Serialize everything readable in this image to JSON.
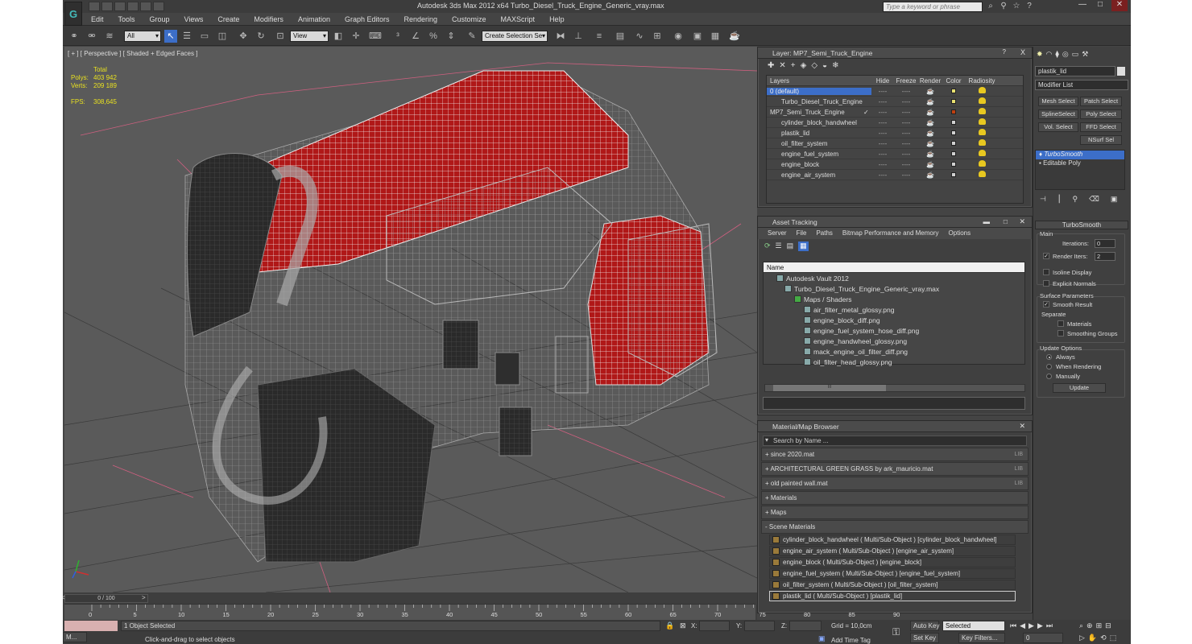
{
  "window": {
    "title": "Autodesk 3ds Max  2012 x64       Turbo_Diesel_Truck_Engine_Generic_vray.max",
    "search_placeholder": "Type a keyword or phrase"
  },
  "menu": [
    "Edit",
    "Tools",
    "Group",
    "Views",
    "Create",
    "Modifiers",
    "Animation",
    "Graph Editors",
    "Rendering",
    "Customize",
    "MAXScript",
    "Help"
  ],
  "toolbar": {
    "selection_filter": "All",
    "ref_coord": "View",
    "named_selection": "Create Selection Se"
  },
  "viewport": {
    "label": "[ + ] [ Perspective ] [ Shaded + Edged Faces ]",
    "stats": {
      "header": "Total",
      "polys_label": "Polys:",
      "polys": "403 942",
      "verts_label": "Verts:",
      "verts": "209 189",
      "fps_label": "FPS:",
      "fps": "308,645"
    }
  },
  "layer_panel": {
    "title": "Layer: MP7_Semi_Truck_Engine",
    "help": "?",
    "close": "X",
    "columns": [
      "Layers",
      "Hide",
      "Freeze",
      "Render",
      "Color",
      "Radiosity"
    ],
    "rows": [
      {
        "name": "0 (default)",
        "color": "#e8e070"
      },
      {
        "name": "Turbo_Diesel_Truck_Engine",
        "color": "#e8e070"
      },
      {
        "name": "MP7_Semi_Truck_Engine",
        "color": "#c04010"
      },
      {
        "name": "cylinder_block_handwheel",
        "color": "#d0d0d0"
      },
      {
        "name": "plastik_lid",
        "color": "#d0d0d0"
      },
      {
        "name": "oil_filter_system",
        "color": "#d0d0d0"
      },
      {
        "name": "engine_fuel_system",
        "color": "#d0d0d0"
      },
      {
        "name": "engine_block",
        "color": "#d0d0d0"
      },
      {
        "name": "engine_air_system",
        "color": "#d0d0d0"
      }
    ],
    "hide_mark": "----",
    "check_mark": "✓"
  },
  "asset_panel": {
    "title": "Asset Tracking",
    "menu": [
      "Server",
      "File",
      "Paths",
      "Bitmap Performance and Memory",
      "Options"
    ],
    "column": "Name",
    "tree": [
      "Autodesk Vault 2012",
      "Turbo_Diesel_Truck_Engine_Generic_vray.max",
      "Maps / Shaders",
      "air_filter_metal_glossy.png",
      "engine_block_diff.png",
      "engine_fuel_system_hose_diff.png",
      "engine_handwheel_glossy.png",
      "mack_engine_oil_filter_diff.png",
      "oil_filter_head_glossy.png"
    ],
    "scroll_grip": "III"
  },
  "material_panel": {
    "title": "Material/Map Browser",
    "search_placeholder": "Search by Name ...",
    "libraries": [
      "+ since 2020.mat",
      "+ ARCHITECTURAL GREEN GRASS by ark_mauricio.mat",
      "+ old painted wall.mat"
    ],
    "lib_tag": "LIB",
    "groups": [
      "+ Materials",
      "+ Maps",
      "- Scene Materials"
    ],
    "scene_materials": [
      "cylinder_block_handwheel  ( Multi/Sub-Object ) [cylinder_block_handwheel]",
      "engine_air_system  ( Multi/Sub-Object ) [engine_air_system]",
      "engine_block  ( Multi/Sub-Object ) [engine_block]",
      "engine_fuel_system  ( Multi/Sub-Object ) [engine_fuel_system]",
      "oil_filter_system  ( Multi/Sub-Object ) [oil_filter_system]",
      "plastik_lid  ( Multi/Sub-Object ) [plastik_lid]"
    ]
  },
  "command_panel": {
    "object_name": "plastik_lid",
    "modifier_list": "Modifier List",
    "buttons": [
      "Mesh Select",
      "Patch Select",
      "SplineSelect",
      "Poly Select",
      "Vol. Select",
      "FFD Select",
      "NSurf Sel"
    ],
    "stack": [
      "TurboSmooth",
      "Editable Poly"
    ],
    "rollout": "TurboSmooth",
    "main": "Main",
    "iterations_label": "Iterations:",
    "iterations": "0",
    "render_iters_label": "Render Iters:",
    "render_iters": "2",
    "isoline": "Isoline Display",
    "explicit": "Explicit Normals",
    "surface": "Surface Parameters",
    "smooth_result": "Smooth Result",
    "separate": "Separate",
    "materials": "Materials",
    "smoothing": "Smoothing Groups",
    "update_options": "Update Options",
    "always": "Always",
    "when_rendering": "When Rendering",
    "manually": "Manually",
    "update_btn": "Update"
  },
  "timeline": {
    "frame": "0 / 100",
    "ticks": [
      "0",
      "5",
      "10",
      "15",
      "20",
      "25",
      "30",
      "35",
      "40",
      "45",
      "50",
      "55",
      "60",
      "65",
      "70",
      "75",
      "80",
      "85",
      "90"
    ]
  },
  "status": {
    "selected": "1 Object Selected",
    "hint": "Click-and-drag to select objects",
    "x": "X:",
    "y": "Y:",
    "z": "Z:",
    "grid": "Grid = 10,0cm",
    "add_time_tag": "Add Time Tag",
    "auto_key": "Auto Key",
    "set_key": "Set Key",
    "key_mode": "Selected",
    "key_filters": "Key Filters...",
    "frame_spin": "0",
    "maxscript": "M..."
  }
}
